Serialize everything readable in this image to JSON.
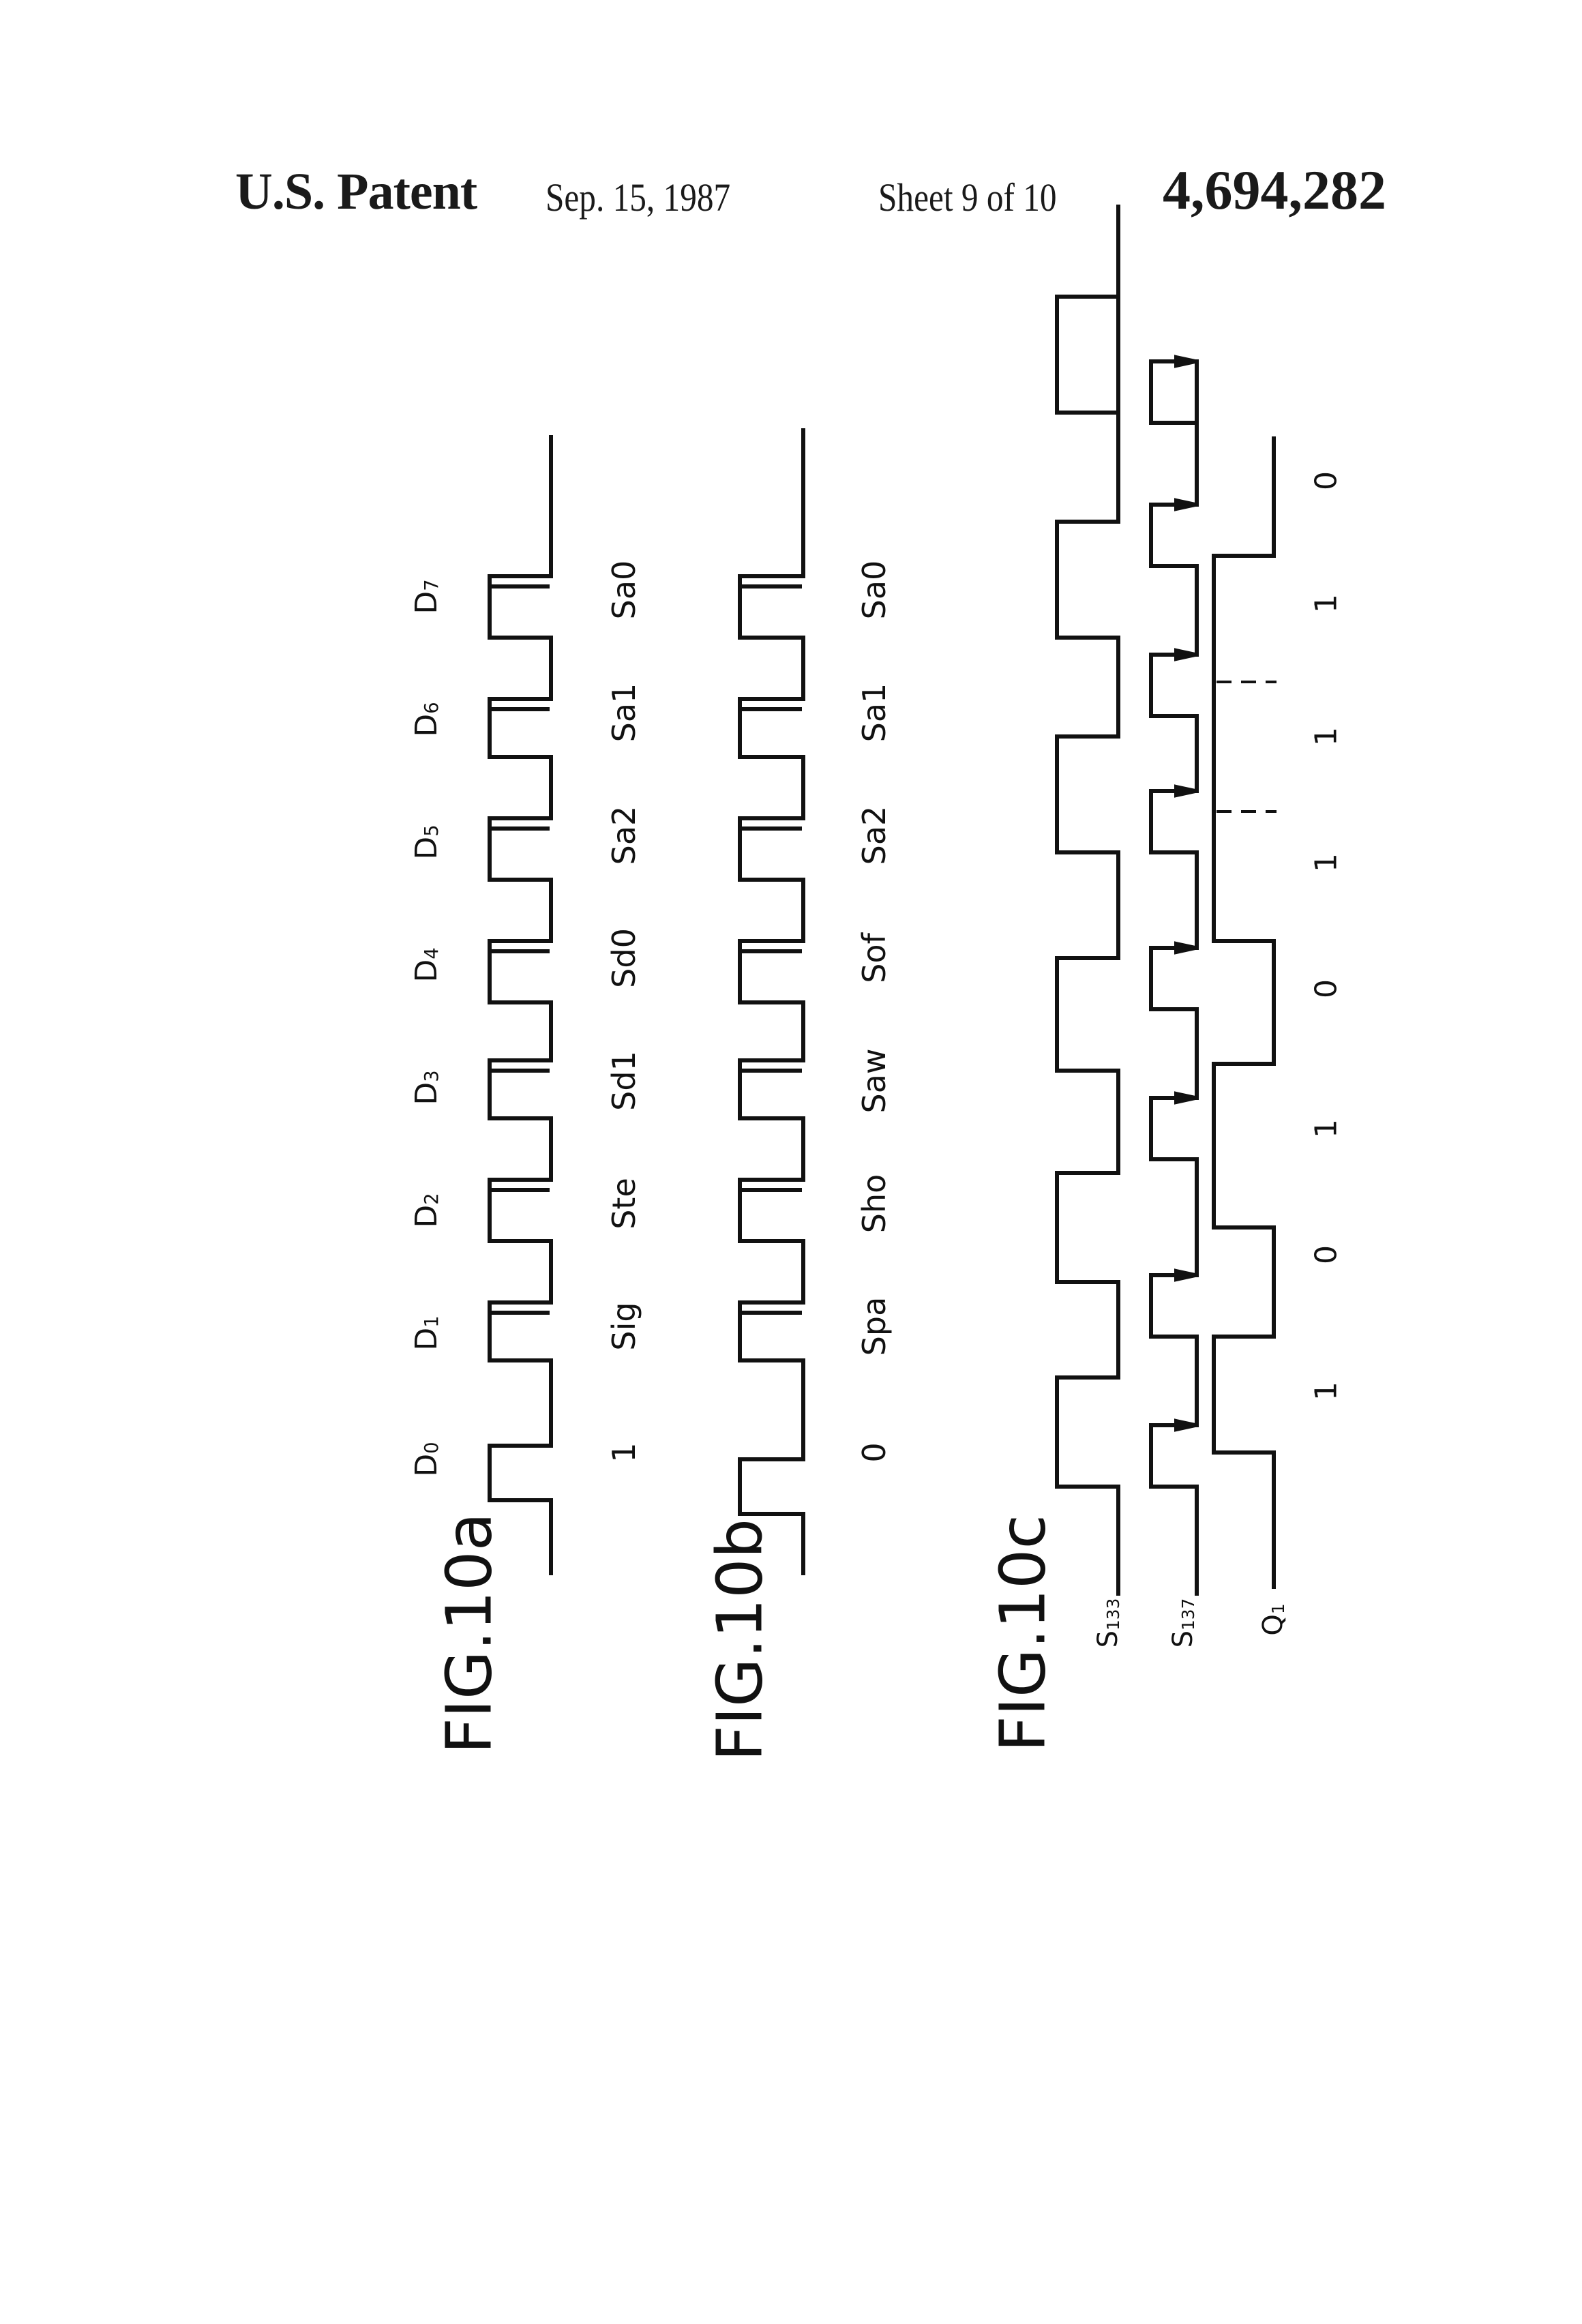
{
  "header": {
    "patent_label": "U.S. Patent",
    "date": "Sep. 15, 1987",
    "sheet": "Sheet 9 of 10",
    "patent_number": "4,694,282"
  },
  "figures": [
    {
      "id": "fig10a",
      "title": "FIG.10a",
      "period_labels": [
        "D0",
        "D1",
        "D2",
        "D3",
        "D4",
        "D5",
        "D6",
        "D7"
      ],
      "value_labels": [
        "1",
        "Sig",
        "Ste",
        "Sd1",
        "Sd0",
        "Sa2",
        "Sa1",
        "Sa0"
      ],
      "waveform": "pulse-width coded: first period wide pulse, remaining periods narrow pulses"
    },
    {
      "id": "fig10b",
      "title": "FIG.10b",
      "value_labels": [
        "0",
        "Spa",
        "Sho",
        "Saw",
        "Sof",
        "Sa2",
        "Sa1",
        "Sa0"
      ],
      "waveform": "first period narrow pulse, remaining periods narrow pulses"
    },
    {
      "id": "fig10c",
      "title": "FIG.10c",
      "signals": [
        {
          "name": "S133"
        },
        {
          "name": "S137"
        },
        {
          "name": "Q1"
        }
      ],
      "bit_values": [
        "1",
        "0",
        "1",
        "0",
        "1",
        "1",
        "1",
        "0"
      ]
    }
  ]
}
